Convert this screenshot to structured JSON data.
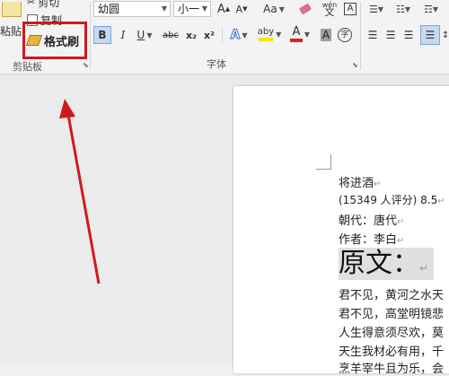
{
  "clipboard": {
    "paste_label": "粘贴",
    "cut_label": "剪切",
    "copy_label": "复制",
    "format_painter_label": "格式刷",
    "group_label": "剪贴板"
  },
  "font": {
    "font_name": "幼圆",
    "font_size": "小一",
    "grow_label": "A",
    "shrink_label": "A",
    "case_label": "Aa",
    "phonetic_label": "wén",
    "group_label": "字体",
    "bold": "B",
    "italic": "I",
    "underline": "U",
    "strike": "abc",
    "subscript": "x₂",
    "superscript": "x²",
    "highlight_label": "aby",
    "font_color_label": "A",
    "char_shade_label": "A",
    "enclose_label": "字"
  },
  "document": {
    "lines": [
      "将进酒",
      "(15349 人评分) 8.5",
      "朝代：唐代",
      "作者：李白"
    ],
    "heading": "原文：",
    "body_lines": [
      "君不见，黄河之水天",
      "君不见，高堂明镜悲",
      "人生得意须尽欢，莫",
      "天生我材必有用，千",
      "烹羊宰牛且为乐，会"
    ],
    "paragraph_mark": "↵"
  },
  "colors": {
    "annotation": "#d0191f",
    "highlight_yellow": "#f5e600",
    "font_color_red": "#e02020",
    "active_blue": "#2b579a"
  }
}
